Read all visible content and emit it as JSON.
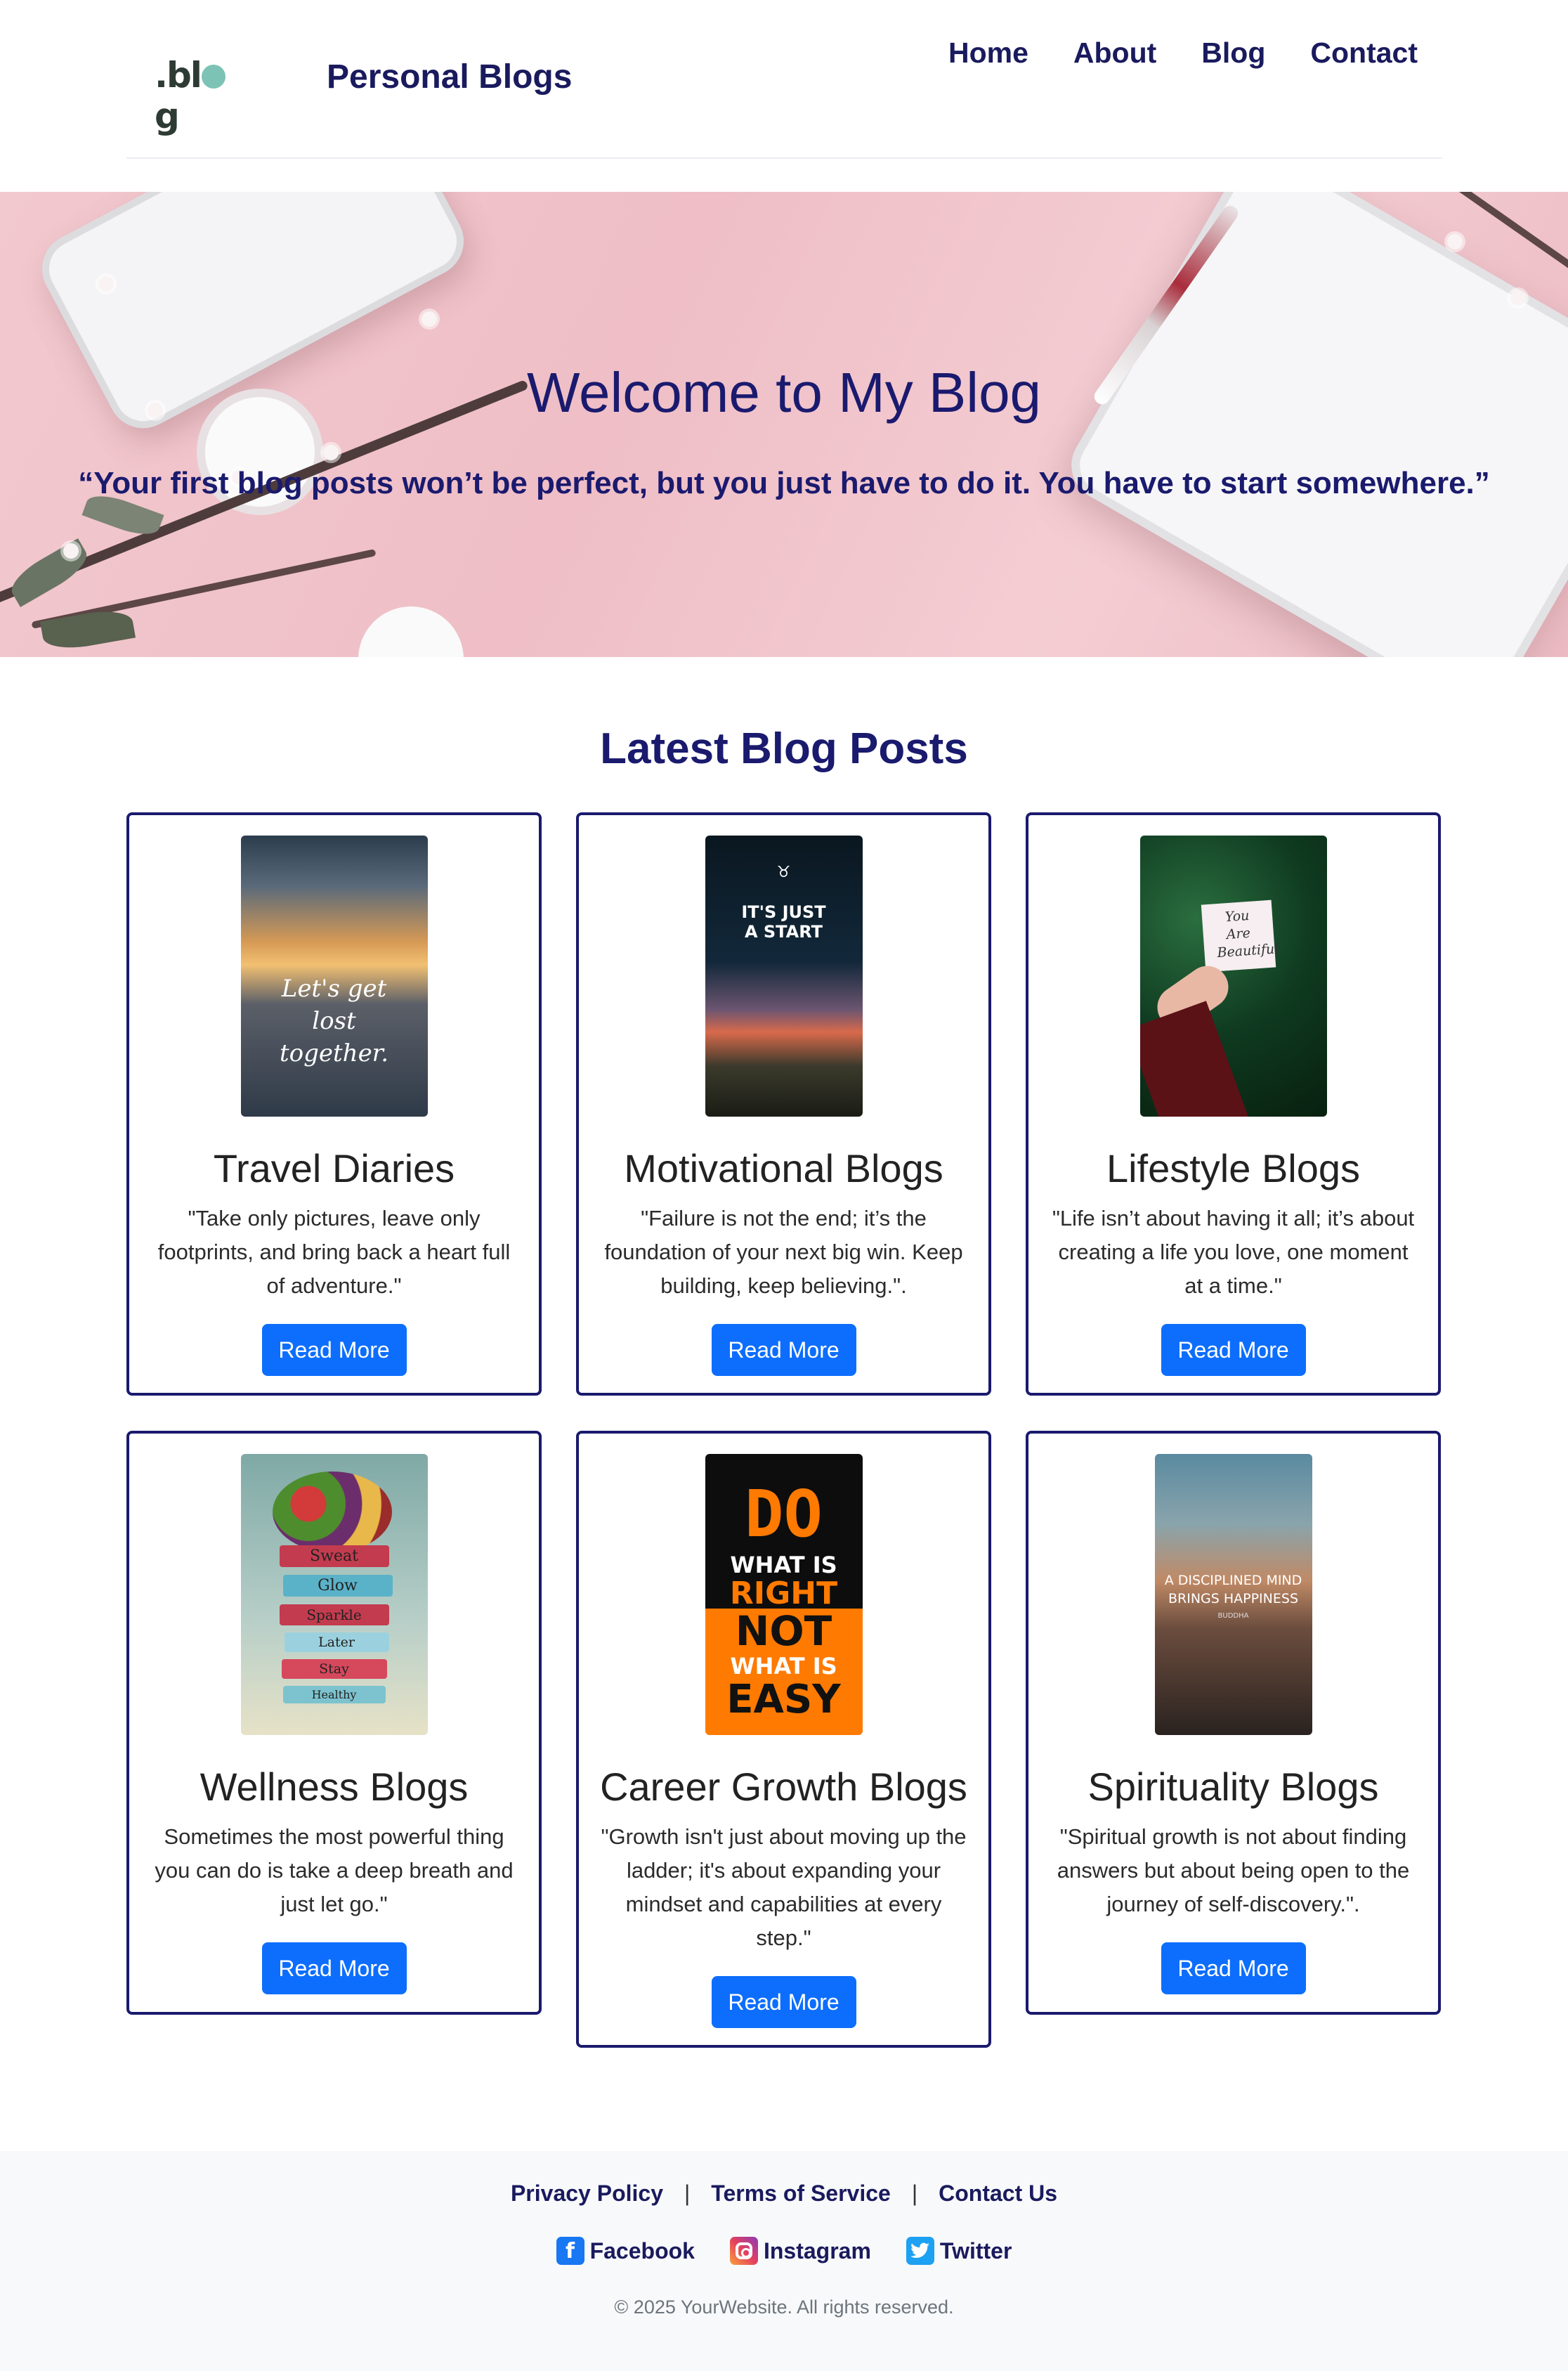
{
  "header": {
    "logo_text": ".blog",
    "site_title": "Personal Blogs",
    "nav": [
      "Home",
      "About",
      "Blog",
      "Contact"
    ]
  },
  "hero": {
    "title": "Welcome to My Blog",
    "quote": "“Your first blog posts won’t be perfect, but you just have to do it. You have to start somewhere.”"
  },
  "posts": {
    "section_title": "Latest Blog Posts",
    "read_more_label": "Read More",
    "items": [
      {
        "title": "Travel Diaries",
        "text": "\"Take only pictures, leave only footprints, and bring back a heart full of adventure.\"",
        "image_text": "Let's get lost together."
      },
      {
        "title": "Motivational Blogs",
        "text": "\"Failure is not the end; it’s the foundation of your next big win. Keep building, keep believing.\".",
        "image_text": "IT'S JUST A START"
      },
      {
        "title": "Lifestyle Blogs",
        "text": "\"Life isn’t about having it all; it’s about creating a life you love, one moment at a time.\"",
        "image_text": "You Are Beautiful"
      },
      {
        "title": "Wellness Blogs",
        "text": "Sometimes the most powerful thing you can do is take a deep breath and just let go.\"",
        "image_text": [
          "Sweat",
          "Glow",
          "Sparkle",
          "Later",
          "Stay",
          "Healthy"
        ]
      },
      {
        "title": "Career Growth Blogs",
        "text": "\"Growth isn't just about moving up the ladder; it's about expanding your mindset and capabilities at every step.\"",
        "image_text": [
          "DO",
          "WHAT IS",
          "RIGHT",
          "NOT",
          "WHAT IS",
          "EASY"
        ]
      },
      {
        "title": "Spirituality Blogs",
        "text": "\"Spiritual growth is not about finding answers but about being open to the journey of self-discovery.\".",
        "image_text": [
          "A DISCIPLINED MIND",
          "BRINGS HAPPINESS",
          "BUDDHA"
        ]
      }
    ]
  },
  "footer": {
    "links": [
      "Privacy Policy",
      "Terms of Service",
      "Contact Us"
    ],
    "separator": "|",
    "social": [
      {
        "label": "Facebook",
        "icon": "facebook-icon"
      },
      {
        "label": "Instagram",
        "icon": "instagram-icon"
      },
      {
        "label": "Twitter",
        "icon": "twitter-icon"
      }
    ],
    "copyright": "© 2025 YourWebsite. All rights reserved."
  },
  "colors": {
    "navy": "#1a1a6e",
    "button_blue": "#0d6efd",
    "hero_pink": "#efbec6",
    "footer_bg": "#f8f9fa"
  }
}
